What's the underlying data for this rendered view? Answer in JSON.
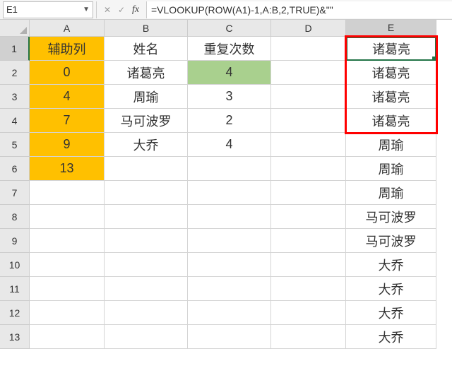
{
  "formula_bar": {
    "name_box": "E1",
    "formula": "=VLOOKUP(ROW(A1)-1,A:B,2,TRUE)&\"\""
  },
  "columns": [
    "A",
    "B",
    "C",
    "D",
    "E"
  ],
  "row_numbers": [
    "1",
    "2",
    "3",
    "4",
    "5",
    "6",
    "7",
    "8",
    "9",
    "10",
    "11",
    "12",
    "13"
  ],
  "cells": {
    "A1": "辅助列",
    "A2": "0",
    "A3": "4",
    "A4": "7",
    "A5": "9",
    "A6": "13",
    "B1": "姓名",
    "B2": "诸葛亮",
    "B3": "周瑜",
    "B4": "马可波罗",
    "B5": "大乔",
    "C1": "重复次数",
    "C2": "4",
    "C3": "3",
    "C4": "2",
    "C5": "4",
    "E1": "诸葛亮",
    "E2": "诸葛亮",
    "E3": "诸葛亮",
    "E4": "诸葛亮",
    "E5": "周瑜",
    "E6": "周瑜",
    "E7": "周瑜",
    "E8": "马可波罗",
    "E9": "马可波罗",
    "E10": "大乔",
    "E11": "大乔",
    "E12": "大乔",
    "E13": "大乔"
  },
  "selected_cell": "E1"
}
